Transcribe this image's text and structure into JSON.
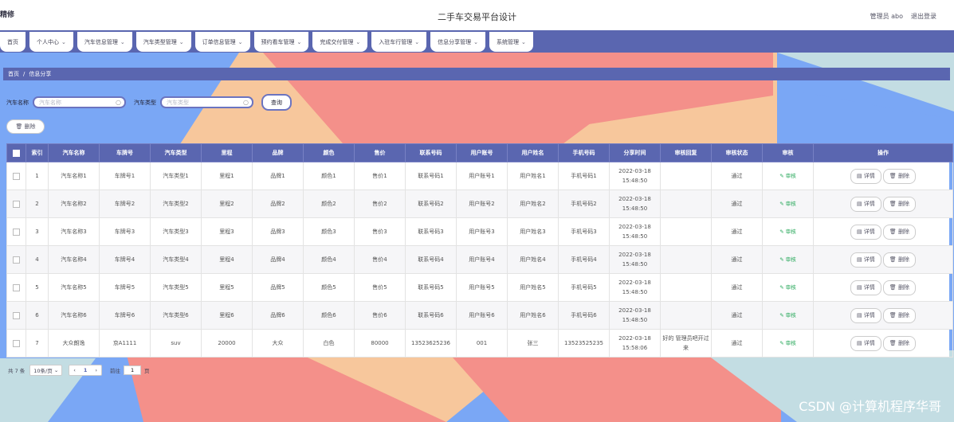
{
  "header": {
    "logo": "精修",
    "title": "二手车交易平台设计",
    "user": "管理员 abo",
    "logout": "退出登录"
  },
  "nav": [
    {
      "label": "首页",
      "dropdown": false
    },
    {
      "label": "个人中心",
      "dropdown": true
    },
    {
      "label": "汽车信息管理",
      "dropdown": true
    },
    {
      "label": "汽车类型管理",
      "dropdown": true
    },
    {
      "label": "订单信息管理",
      "dropdown": true
    },
    {
      "label": "预约看车管理",
      "dropdown": true
    },
    {
      "label": "完成交付管理",
      "dropdown": true
    },
    {
      "label": "入驻车行管理",
      "dropdown": true
    },
    {
      "label": "信息分享管理",
      "dropdown": true
    },
    {
      "label": "系统管理",
      "dropdown": true
    }
  ],
  "breadcrumb": {
    "home": "首页",
    "sep": "/",
    "current": "信息分享"
  },
  "search": {
    "car_name_label": "汽车名称",
    "car_name_placeholder": "汽车名称",
    "car_type_label": "汽车类型",
    "car_type_placeholder": "汽车类型",
    "query_label": "查询"
  },
  "toolbar": {
    "delete_label": "删除"
  },
  "table": {
    "headers": [
      "索引",
      "汽车名称",
      "车牌号",
      "汽车类型",
      "里程",
      "品牌",
      "颜色",
      "售价",
      "联系号码",
      "用户账号",
      "用户姓名",
      "手机号码",
      "分享时间",
      "审核回复",
      "审核状态",
      "审核",
      "操作"
    ],
    "audit_label": "审核",
    "detail_label": "详情",
    "delete_label": "删除",
    "rows": [
      {
        "index": "1",
        "name": "汽车名称1",
        "plate": "车牌号1",
        "type": "汽车类型1",
        "mileage": "里程1",
        "brand": "品牌1",
        "color": "颜色1",
        "price": "售价1",
        "contact": "联系号码1",
        "account": "用户账号1",
        "username": "用户姓名1",
        "phone": "手机号码1",
        "time": "2022-03-18 15:48:50",
        "reply": "",
        "status": "通过"
      },
      {
        "index": "2",
        "name": "汽车名称2",
        "plate": "车牌号2",
        "type": "汽车类型2",
        "mileage": "里程2",
        "brand": "品牌2",
        "color": "颜色2",
        "price": "售价2",
        "contact": "联系号码2",
        "account": "用户账号2",
        "username": "用户姓名2",
        "phone": "手机号码2",
        "time": "2022-03-18 15:48:50",
        "reply": "",
        "status": "通过"
      },
      {
        "index": "3",
        "name": "汽车名称3",
        "plate": "车牌号3",
        "type": "汽车类型3",
        "mileage": "里程3",
        "brand": "品牌3",
        "color": "颜色3",
        "price": "售价3",
        "contact": "联系号码3",
        "account": "用户账号3",
        "username": "用户姓名3",
        "phone": "手机号码3",
        "time": "2022-03-18 15:48:50",
        "reply": "",
        "status": "通过"
      },
      {
        "index": "4",
        "name": "汽车名称4",
        "plate": "车牌号4",
        "type": "汽车类型4",
        "mileage": "里程4",
        "brand": "品牌4",
        "color": "颜色4",
        "price": "售价4",
        "contact": "联系号码4",
        "account": "用户账号4",
        "username": "用户姓名4",
        "phone": "手机号码4",
        "time": "2022-03-18 15:48:50",
        "reply": "",
        "status": "通过"
      },
      {
        "index": "5",
        "name": "汽车名称5",
        "plate": "车牌号5",
        "type": "汽车类型5",
        "mileage": "里程5",
        "brand": "品牌5",
        "color": "颜色5",
        "price": "售价5",
        "contact": "联系号码5",
        "account": "用户账号5",
        "username": "用户姓名5",
        "phone": "手机号码5",
        "time": "2022-03-18 15:48:50",
        "reply": "",
        "status": "通过"
      },
      {
        "index": "6",
        "name": "汽车名称6",
        "plate": "车牌号6",
        "type": "汽车类型6",
        "mileage": "里程6",
        "brand": "品牌6",
        "color": "颜色6",
        "price": "售价6",
        "contact": "联系号码6",
        "account": "用户账号6",
        "username": "用户姓名6",
        "phone": "手机号码6",
        "time": "2022-03-18 15:48:50",
        "reply": "",
        "status": "通过"
      },
      {
        "index": "7",
        "name": "大众朗逸",
        "plate": "京A1111",
        "type": "suv",
        "mileage": "20000",
        "brand": "大众",
        "color": "白色",
        "price": "80000",
        "contact": "13523625236",
        "account": "001",
        "username": "张三",
        "phone": "13523525235",
        "time": "2022-03-18 15:58:06",
        "reply": "好的 管理员吧开过来",
        "status": "通过"
      }
    ]
  },
  "pagination": {
    "total": "共 7 条",
    "page_size": "10条/页",
    "prev": "‹",
    "current": "1",
    "next": "›",
    "goto_label": "前往",
    "goto_value": "1",
    "page_suffix": "页"
  },
  "watermark": "CSDN @计算机程序华哥",
  "colors": {
    "primary": "#5a66b0",
    "bg_blue": "#7aa7f5",
    "bg_coral": "#f4908a",
    "bg_peach": "#f7c79c",
    "bg_pale": "#c3dde3",
    "audit_green": "#27a85a"
  }
}
